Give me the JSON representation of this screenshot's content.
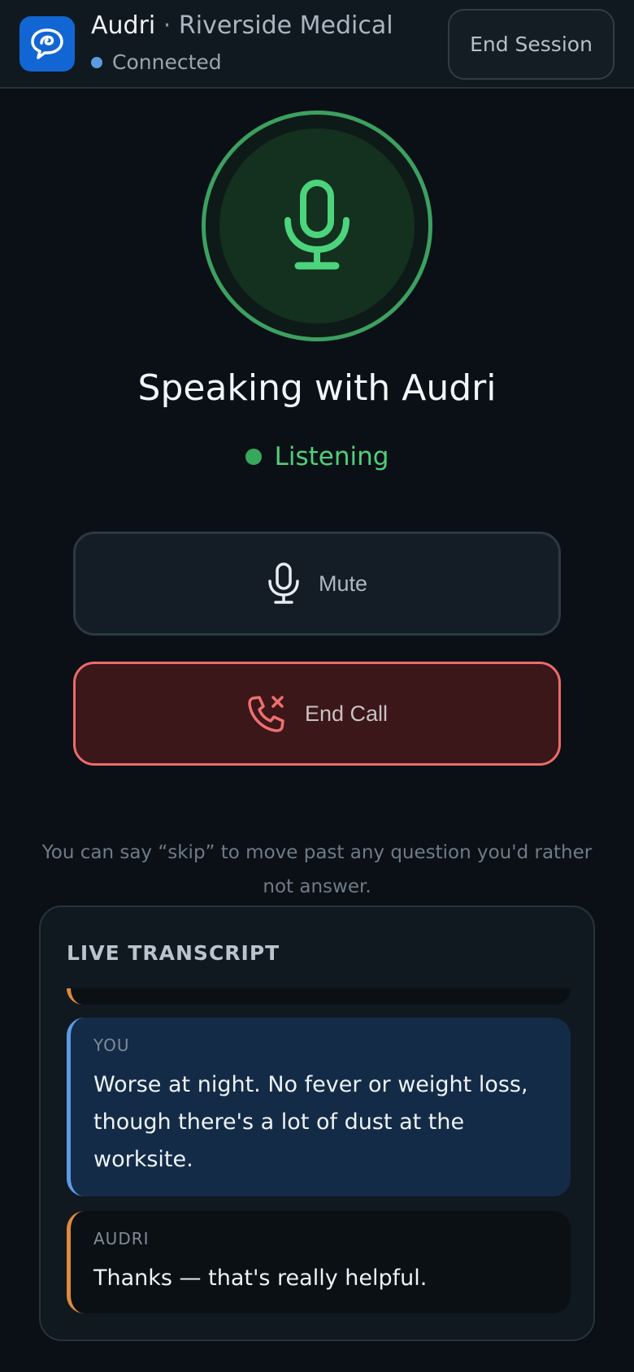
{
  "header": {
    "app_name": "Audri",
    "separator": "·",
    "organization": "Riverside Medical",
    "connection_status": "Connected",
    "end_session_label": "End Session"
  },
  "call": {
    "title": "Speaking with Audri",
    "state": "Listening",
    "mute_label": "Mute",
    "end_call_label": "End Call",
    "hint": "You can say “skip” to move past any question you'd rather not answer."
  },
  "transcript": {
    "title": "LIVE TRANSCRIPT",
    "messages": [
      {
        "speaker": "YOU",
        "text": "Worse at night. No fever or weight loss, though there's a lot of dust at the worksite."
      },
      {
        "speaker": "AUDRI",
        "text": "Thanks — that's really helpful."
      }
    ]
  },
  "colors": {
    "background": "#0b1016",
    "accent_blue": "#1266d4",
    "listening_green": "#4fd07a",
    "end_call_red": "#ec6b6b",
    "user_bubble": "#132b46",
    "assistant_border": "#e08a3c"
  },
  "icons": {
    "logo": "chat-bubble-icon",
    "mic": "microphone-icon",
    "end_call": "phone-x-icon"
  }
}
